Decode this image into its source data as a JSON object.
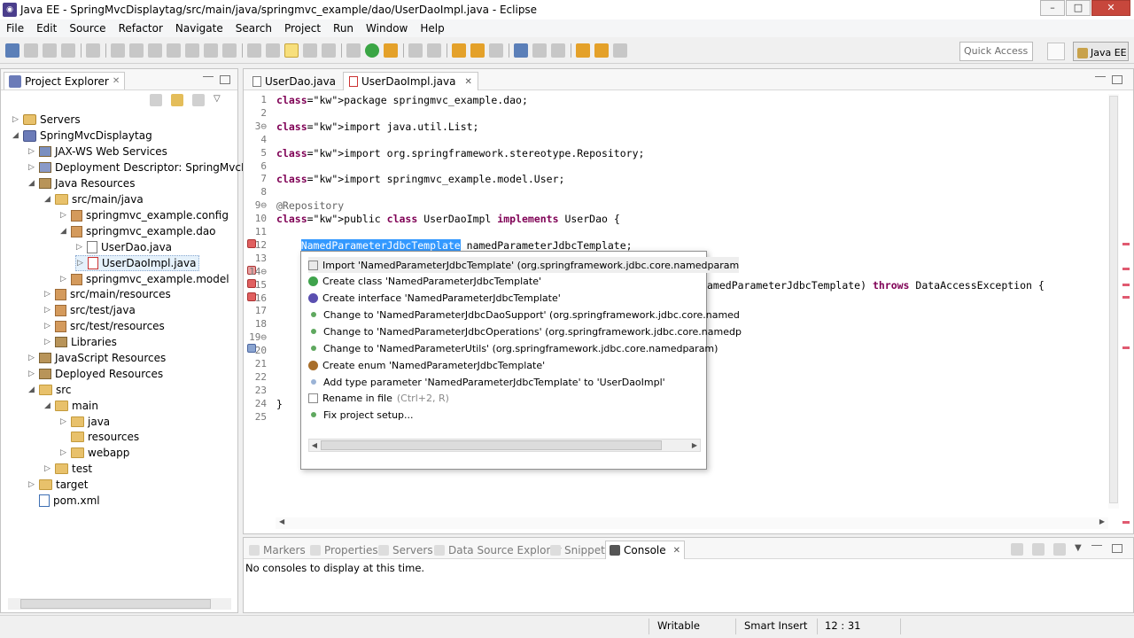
{
  "window": {
    "title": "Java EE - SpringMvcDisplaytag/src/main/java/springmvc_example/dao/UserDaoImpl.java - Eclipse",
    "minimize": "–",
    "maximize": "□",
    "close": "✕"
  },
  "menubar": [
    "File",
    "Edit",
    "Source",
    "Refactor",
    "Navigate",
    "Search",
    "Project",
    "Run",
    "Window",
    "Help"
  ],
  "toolbar": {
    "quick_access": "Quick Access",
    "perspective": "Java EE"
  },
  "explorer": {
    "title": "Project Explorer",
    "tree": [
      {
        "label": "Servers",
        "arrow": "▷",
        "icon": "server-folder-icon"
      },
      {
        "label": "SpringMvcDisplaytag",
        "arrow": "◢",
        "icon": "project-icon"
      },
      {
        "label": "JAX-WS Web Services",
        "arrow": "▷",
        "icon": "webservices-icon"
      },
      {
        "label": "Deployment Descriptor: SpringMvcDispla",
        "arrow": "▷",
        "icon": "descriptor-icon"
      },
      {
        "label": "Java Resources",
        "arrow": "◢",
        "icon": "java-resources-icon"
      },
      {
        "label": "src/main/java",
        "arrow": "◢",
        "icon": "source-folder-icon"
      },
      {
        "label": "springmvc_example.config",
        "arrow": "▷",
        "icon": "package-icon"
      },
      {
        "label": "springmvc_example.dao",
        "arrow": "◢",
        "icon": "package-icon"
      },
      {
        "label": "UserDao.java",
        "arrow": "▷",
        "icon": "java-file-icon"
      },
      {
        "label": "UserDaoImpl.java",
        "arrow": "▷",
        "icon": "java-file-error-icon"
      },
      {
        "label": "springmvc_example.model",
        "arrow": "▷",
        "icon": "package-icon"
      },
      {
        "label": "src/main/resources",
        "arrow": "▷",
        "icon": "source-folder-icon"
      },
      {
        "label": "src/test/java",
        "arrow": "▷",
        "icon": "source-folder-icon"
      },
      {
        "label": "src/test/resources",
        "arrow": "▷",
        "icon": "source-folder-icon"
      },
      {
        "label": "Libraries",
        "arrow": "▷",
        "icon": "libraries-icon"
      },
      {
        "label": "JavaScript Resources",
        "arrow": "▷",
        "icon": "js-resources-icon"
      },
      {
        "label": "Deployed Resources",
        "arrow": "▷",
        "icon": "deployed-resources-icon"
      },
      {
        "label": "src",
        "arrow": "◢",
        "icon": "folder-icon"
      },
      {
        "label": "main",
        "arrow": "◢",
        "icon": "folder-icon"
      },
      {
        "label": "java",
        "arrow": "▷",
        "icon": "folder-icon"
      },
      {
        "label": "resources",
        "arrow": "",
        "icon": "folder-icon"
      },
      {
        "label": "webapp",
        "arrow": "▷",
        "icon": "folder-icon"
      },
      {
        "label": "test",
        "arrow": "▷",
        "icon": "folder-icon"
      },
      {
        "label": "target",
        "arrow": "▷",
        "icon": "folder-icon"
      },
      {
        "label": "pom.xml",
        "arrow": "",
        "icon": "xml-file-icon"
      }
    ]
  },
  "editor": {
    "tabs": [
      {
        "label": "UserDao.java"
      },
      {
        "label": "UserDaoImpl.java",
        "close": "✕"
      }
    ],
    "lines": [
      {
        "n": "1",
        "code": "package springmvc_example.dao;"
      },
      {
        "n": "2",
        "code": ""
      },
      {
        "n": "3⊖",
        "code": "import java.util.List;"
      },
      {
        "n": "4",
        "code": ""
      },
      {
        "n": "5",
        "code": "import org.springframework.stereotype.Repository;"
      },
      {
        "n": "6",
        "code": ""
      },
      {
        "n": "7",
        "code": "import springmvc_example.model.User;"
      },
      {
        "n": "8",
        "code": ""
      },
      {
        "n": "9⊖",
        "code": "@Repository"
      },
      {
        "n": "10",
        "code": "public class UserDaoImpl implements UserDao {"
      },
      {
        "n": "11",
        "code": ""
      },
      {
        "n": "12",
        "code": "    NamedParameterJdbcTemplate namedParameterJdbcTemplate;"
      },
      {
        "n": "13",
        "code": ""
      },
      {
        "n": "14⊖",
        "code": ""
      },
      {
        "n": "15",
        "code": ""
      },
      {
        "n": "16",
        "code": ""
      },
      {
        "n": "17",
        "code": ""
      },
      {
        "n": "18",
        "code": ""
      },
      {
        "n": "19⊖",
        "code": ""
      },
      {
        "n": "20",
        "code": ""
      },
      {
        "n": "21",
        "code": ""
      },
      {
        "n": "22",
        "code": ""
      },
      {
        "n": "23",
        "code": ""
      },
      {
        "n": "24",
        "code": "}"
      },
      {
        "n": "25",
        "code": ""
      }
    ],
    "line15_tail": "amedParameterJdbcTemplate) throws DataAccessException {",
    "selected_token": "NamedParameterJdbcTemplate",
    "field_name": " namedParameterJdbcTemplate;"
  },
  "quickfix": {
    "items": [
      {
        "label": "Import 'NamedParameterJdbcTemplate' (org.springframework.jdbc.core.namedparam",
        "icon": "import-icon"
      },
      {
        "label": "Create class 'NamedParameterJdbcTemplate'",
        "icon": "class-icon"
      },
      {
        "label": "Create interface 'NamedParameterJdbcTemplate'",
        "icon": "interface-icon"
      },
      {
        "label": "Change to 'NamedParameterJdbcDaoSupport' (org.springframework.jdbc.core.named",
        "icon": "change-icon"
      },
      {
        "label": "Change to 'NamedParameterJdbcOperations' (org.springframework.jdbc.core.namedp",
        "icon": "change-icon"
      },
      {
        "label": "Change to 'NamedParameterUtils' (org.springframework.jdbc.core.namedparam)",
        "icon": "change-icon"
      },
      {
        "label": "Create enum 'NamedParameterJdbcTemplate'",
        "icon": "enum-icon"
      },
      {
        "label": "Add type parameter 'NamedParameterJdbcTemplate' to 'UserDaoImpl'",
        "icon": "type-param-icon"
      },
      {
        "label": "Rename in file",
        "hint": " (Ctrl+2, R)",
        "icon": "rename-icon"
      },
      {
        "label": "Fix project setup...",
        "icon": "fix-setup-icon"
      }
    ]
  },
  "bottom_panel": {
    "tabs": [
      "Markers",
      "Properties",
      "Servers",
      "Data Source Explorer",
      "Snippets",
      "Console"
    ],
    "active_tab": "Console",
    "message": "No consoles to display at this time."
  },
  "status": {
    "writable": "Writable",
    "insert_mode": "Smart Insert",
    "position": "12 : 31"
  },
  "colors": {
    "keyword": "#7f0055",
    "selection": "#3399ff",
    "error": "#e06060"
  }
}
